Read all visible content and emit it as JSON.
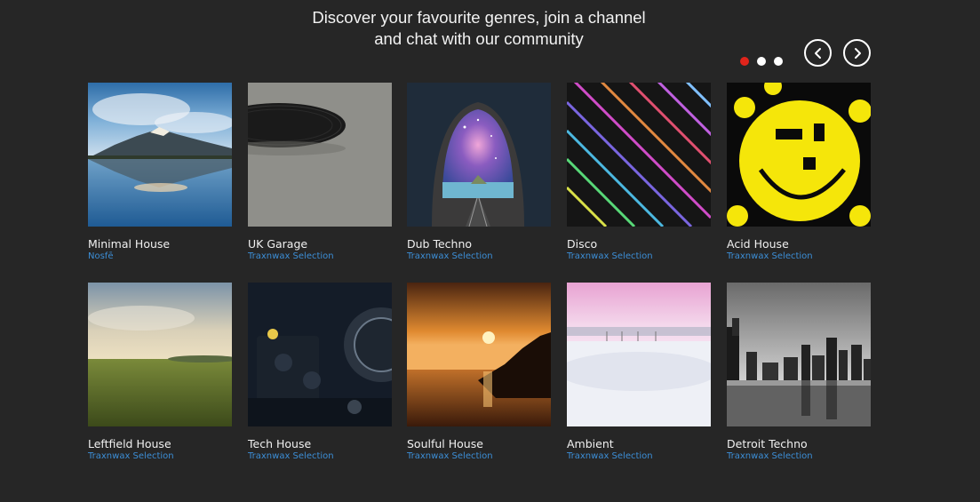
{
  "header": {
    "line1": "Discover your favourite genres, join a channel",
    "line2": "and chat with our community"
  },
  "carousel": {
    "pages": 3,
    "active_page": 1,
    "active_dot_color": "#e0241b",
    "prev_icon": "chevron-left-icon",
    "next_icon": "chevron-right-icon"
  },
  "genres": [
    {
      "title": "Minimal House",
      "curator": "Nosfē",
      "image": "mountain-lake-reflection"
    },
    {
      "title": "UK Garage",
      "curator": "Traxnwax Selection",
      "image": "vinyl-record-edge"
    },
    {
      "title": "Dub Techno",
      "curator": "Traxnwax Selection",
      "image": "tunnel-to-galaxy"
    },
    {
      "title": "Disco",
      "curator": "Traxnwax Selection",
      "image": "neon-diagonal-lines"
    },
    {
      "title": "Acid House",
      "curator": "Traxnwax Selection",
      "image": "yellow-smiley-faces"
    },
    {
      "title": "Leftfield House",
      "curator": "Traxnwax Selection",
      "image": "green-field-sunrise"
    },
    {
      "title": "Tech House",
      "curator": "Traxnwax Selection",
      "image": "dj-turntable"
    },
    {
      "title": "Soulful House",
      "curator": "Traxnwax Selection",
      "image": "sunset-over-sea"
    },
    {
      "title": "Ambient",
      "curator": "Traxnwax Selection",
      "image": "pink-misty-lake"
    },
    {
      "title": "Detroit Techno",
      "curator": "Traxnwax Selection",
      "image": "city-skyline-bw"
    }
  ]
}
